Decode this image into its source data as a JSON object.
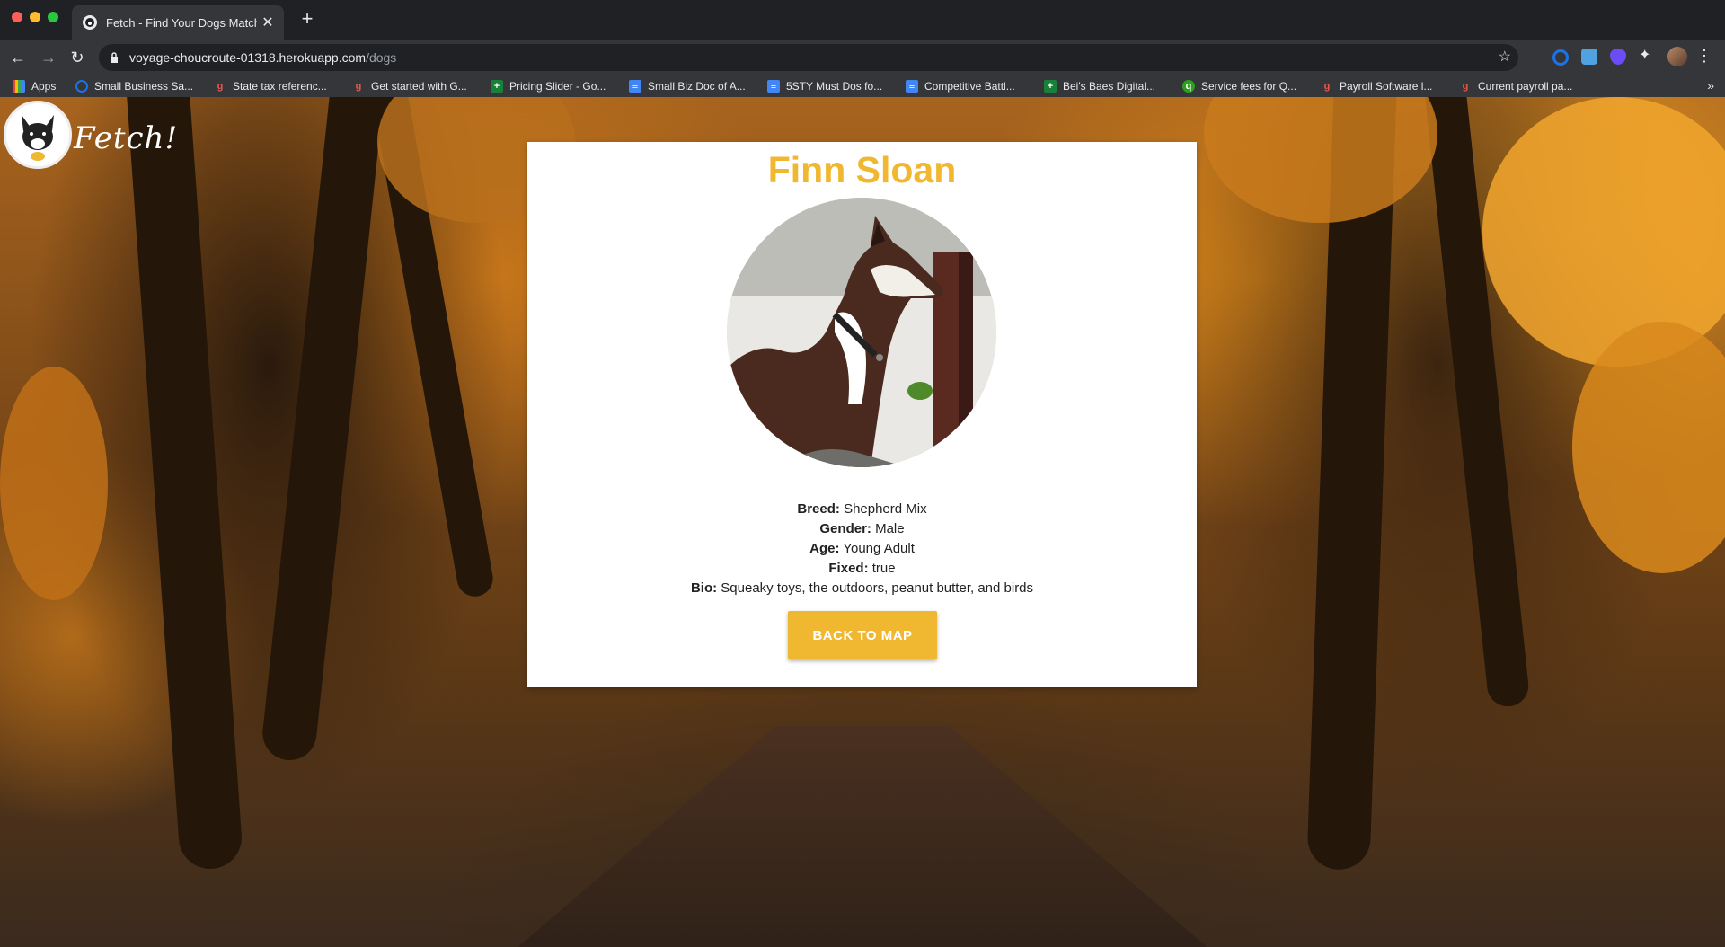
{
  "browser": {
    "tab_title": "Fetch - Find Your Dogs Match",
    "url_host": "voyage-choucroute-01318.herokuapp.com",
    "url_path": "/dogs",
    "bookmarks": [
      {
        "label": "Apps",
        "icon": "apps-grid-icon"
      },
      {
        "label": "Small Business Sa...",
        "icon": "circle-icon"
      },
      {
        "label": "State tax referenc...",
        "icon": "g-icon"
      },
      {
        "label": "Get started with G...",
        "icon": "g-icon"
      },
      {
        "label": "Pricing Slider - Go...",
        "icon": "sheets-icon"
      },
      {
        "label": "Small Biz Doc of A...",
        "icon": "docs-icon"
      },
      {
        "label": "5STY Must Dos fo...",
        "icon": "docs-icon"
      },
      {
        "label": "Competitive Battl...",
        "icon": "docs-icon"
      },
      {
        "label": "Bei's Baes Digital...",
        "icon": "sheets-icon"
      },
      {
        "label": "Service fees for Q...",
        "icon": "qb-icon"
      },
      {
        "label": "Payroll Software l...",
        "icon": "g-icon"
      },
      {
        "label": "Current payroll pa...",
        "icon": "g-icon"
      }
    ]
  },
  "page": {
    "brand": "Fetch!",
    "dog": {
      "name": "Finn Sloan",
      "breed_label": "Breed:",
      "breed": "Shepherd Mix",
      "gender_label": "Gender:",
      "gender": "Male",
      "age_label": "Age:",
      "age": "Young Adult",
      "fixed_label": "Fixed:",
      "fixed": "true",
      "bio_label": "Bio:",
      "bio": "Squeaky toys, the outdoors, peanut butter, and birds"
    },
    "back_button": "BACK TO MAP"
  },
  "colors": {
    "accent": "#f0b730",
    "card_bg": "#ffffff"
  }
}
